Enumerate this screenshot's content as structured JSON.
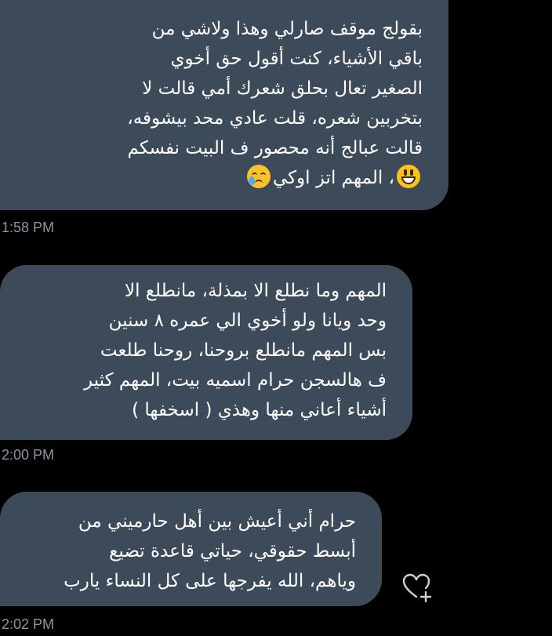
{
  "messages": [
    {
      "lines": [
        "بقولج موقف صارلي وهذا ولاشي من",
        "باقي الأشياء، كنت أقول حق أخوي",
        "الصغير تعال بحلق شعرك أمي قالت لا",
        "بتخربين شعره، قلت عادي محد بيشوفه،",
        "قالت عبالج أنه محصور ف البيت نفسكم",
        "، المهم اتز اوكي"
      ],
      "emojis": [
        "smiling-face-with-open-mouth",
        "crying-face"
      ],
      "time": "1:58 PM"
    },
    {
      "lines": [
        "المهم وما نطلع الا بمذلة، مانطلع الا",
        "وحد ويانا ولو أخوي الي عمره ٨ سنين",
        "بس المهم مانطلع بروحنا، روحنا طلعت",
        "ف هالسجن حرام اسميه بيت، المهم كثير",
        "أشياء أعاني منها وهذي ( اسخفها )"
      ],
      "time": "2:00 PM"
    },
    {
      "lines": [
        "حرام أني أعيش بين أهل حارميني من",
        "أبسط حقوقي، حياتي قاعدة تضيع",
        "وياهم، الله يفرجها على كل النساء يارب"
      ],
      "time": "2:02 PM"
    }
  ],
  "reaction_icon": "heart-plus-icon",
  "colors": {
    "background": "#000000",
    "bubble": "#3d4a5a",
    "text": "#ffffff",
    "timestamp": "#8a96a3",
    "heart_icon": "#c9d1d9"
  }
}
